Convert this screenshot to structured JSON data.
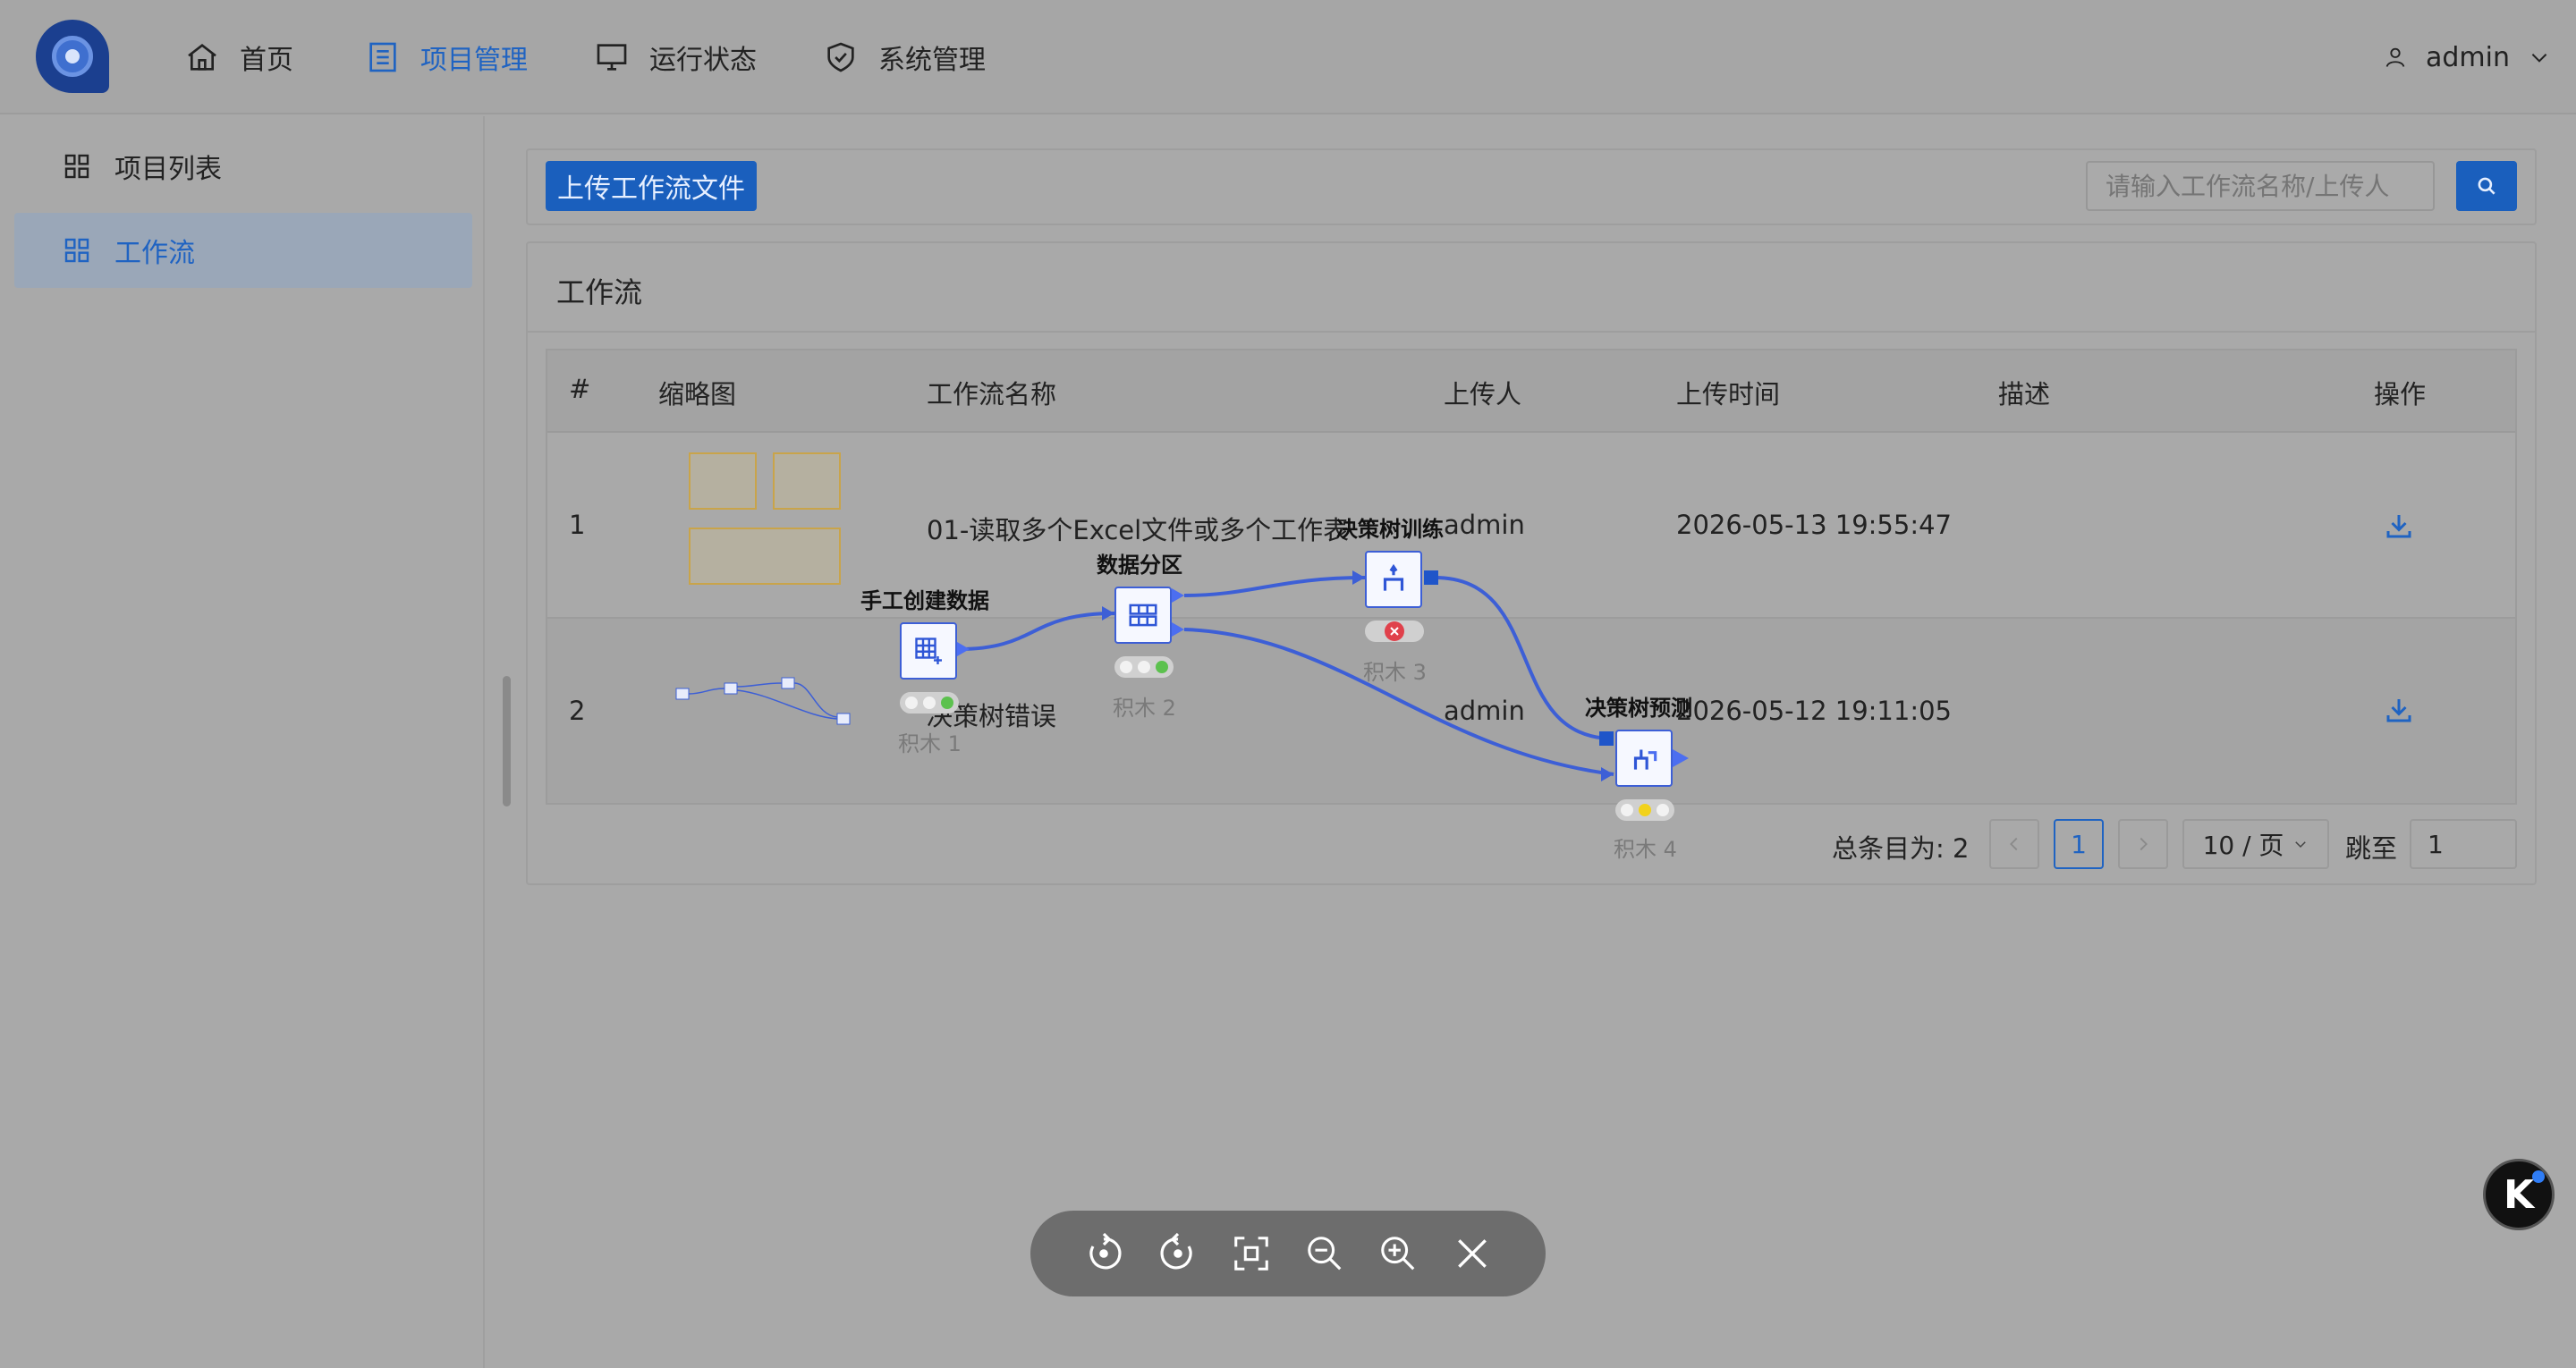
{
  "header": {
    "nav": [
      {
        "label": "首页",
        "icon": "home-icon"
      },
      {
        "label": "项目管理",
        "icon": "list-icon",
        "active": true
      },
      {
        "label": "运行状态",
        "icon": "monitor-icon"
      },
      {
        "label": "系统管理",
        "icon": "shield-icon"
      }
    ],
    "user": "admin"
  },
  "sidebar": {
    "items": [
      {
        "label": "项目列表",
        "icon": "grid-icon"
      },
      {
        "label": "工作流",
        "icon": "grid-icon",
        "active": true
      }
    ]
  },
  "toolbar": {
    "upload_label": "上传工作流文件",
    "search_placeholder": "请输入工作流名称/上传人"
  },
  "card": {
    "title": "工作流",
    "columns": [
      "#",
      "缩略图",
      "工作流名称",
      "上传人",
      "上传时间",
      "描述",
      "操作"
    ],
    "rows": [
      {
        "index": "1",
        "name": "01-读取多个Excel文件或多个工作表",
        "uploader": "admin",
        "time": "2026-05-13 19:55:47",
        "desc": ""
      },
      {
        "index": "2",
        "name": "决策树错误",
        "uploader": "admin",
        "time": "2026-05-12 19:11:05",
        "desc": ""
      }
    ]
  },
  "pagination": {
    "total_label": "总条目为: 2",
    "current_page": "1",
    "page_size": "10 / 页",
    "jump_label": "跳至",
    "jump_value": "1"
  },
  "workflow": {
    "nodes": [
      {
        "title": "手工创建数据",
        "sub": "积木 1",
        "status": [
          "off",
          "off",
          "green"
        ]
      },
      {
        "title": "数据分区",
        "sub": "积木 2",
        "status": [
          "off",
          "off",
          "green"
        ]
      },
      {
        "title": "决策树训练",
        "sub": "积木 3",
        "status": [
          "error"
        ]
      },
      {
        "title": "决策树预测",
        "sub": "积木 4",
        "status": [
          "off",
          "yellow",
          "off"
        ]
      }
    ],
    "colors": {
      "edge": "#3d5fd6",
      "green": "#5cc14e",
      "yellow": "#f2d21a",
      "error": "#e0414b"
    }
  },
  "viewer": {
    "buttons": [
      "rotate-left-icon",
      "rotate-right-icon",
      "fit-screen-icon",
      "zoom-out-icon",
      "zoom-in-icon",
      "close-icon"
    ]
  },
  "badge": {
    "letter": "K"
  }
}
